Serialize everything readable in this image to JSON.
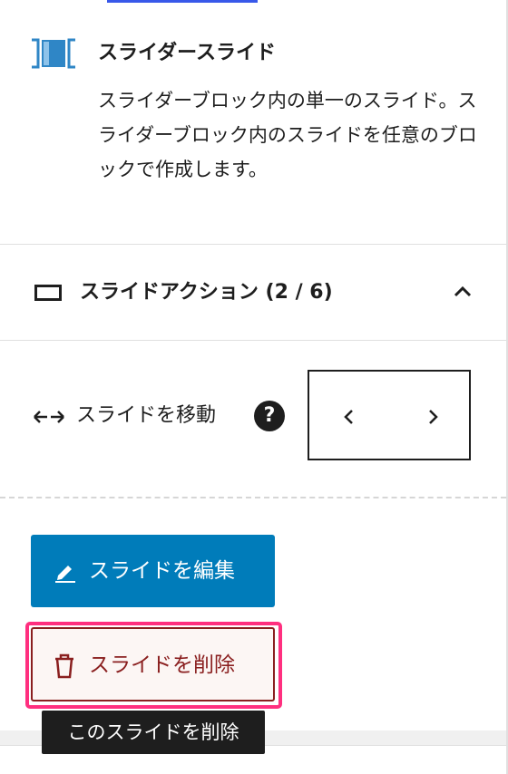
{
  "block_card": {
    "title": "スライダースライド",
    "description": "スライダーブロック内の単一のスライド。スライダーブロック内のスライドを任意のブロックで作成します。",
    "icon": "slider-slide-icon"
  },
  "panel": {
    "title": "スライドアクション (2 / 6)",
    "icon": "rectangle-icon",
    "toggle_icon": "chevron-up-icon"
  },
  "move": {
    "label": "スライドを移動",
    "help_symbol": "?",
    "prev_icon": "chevron-left-icon",
    "next_icon": "chevron-right-icon"
  },
  "actions": {
    "edit_label": "スライドを編集",
    "edit_icon": "pencil-icon",
    "delete_label": "スライドを削除",
    "delete_icon": "trash-icon",
    "delete_tooltip": "このスライドを削除"
  },
  "colors": {
    "primary": "#007cba",
    "danger": "#8a1f1f",
    "highlight": "#ff2f7f",
    "tab_accent": "#3858e9"
  }
}
